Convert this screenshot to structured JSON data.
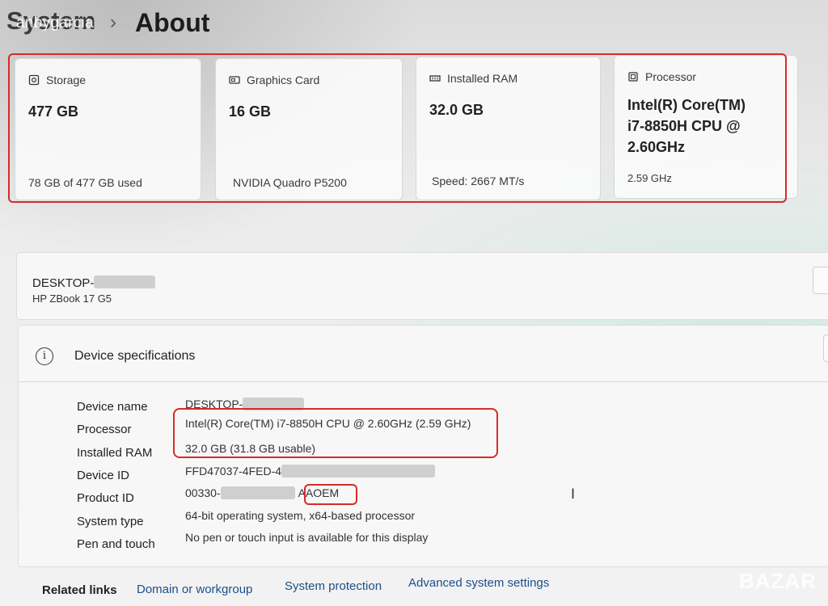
{
  "header": {
    "parent": "System",
    "watermark": "anbygarcia",
    "separator": "›",
    "current": "About"
  },
  "cards": [
    {
      "icon": "storage-icon",
      "title": "Storage",
      "value": "477 GB",
      "sub": "78 GB of 477 GB used"
    },
    {
      "icon": "graphics-card-icon",
      "title": "Graphics Card",
      "value": "16 GB",
      "sub": "NVIDIA Quadro P5200"
    },
    {
      "icon": "ram-icon",
      "title": "Installed RAM",
      "value": "32.0 GB",
      "sub": "Speed: 2667 MT/s"
    },
    {
      "icon": "processor-icon",
      "title": "Processor",
      "value": "Intel(R) Core(TM) i7-8850H CPU @ 2.60GHz",
      "sub": "2.59 GHz"
    }
  ],
  "device": {
    "name": "DESKTOP-",
    "model": "HP ZBook 17 G5"
  },
  "specs": {
    "title": "Device specifications",
    "rows": [
      {
        "label": "Device name",
        "value": "DESKTOP-"
      },
      {
        "label": "Processor",
        "value": "Intel(R) Core(TM) i7-8850H CPU @ 2.60GHz (2.59 GHz)"
      },
      {
        "label": "Installed RAM",
        "value": "32.0 GB (31.8 GB usable)"
      },
      {
        "label": "Device ID",
        "value": "FFD47037-4FED-4"
      },
      {
        "label": "Product ID",
        "value": "00330-",
        "value_suffix": "AAOEM"
      },
      {
        "label": "System type",
        "value": "64-bit operating system, x64-based processor"
      },
      {
        "label": "Pen and touch",
        "value": "No pen or touch input is available for this display"
      }
    ]
  },
  "related": {
    "label": "Related links",
    "links": [
      "Domain or workgroup",
      "System protection",
      "Advanced system settings"
    ]
  },
  "brand_watermark": "BAZAR",
  "colors": {
    "highlight": "#d62b2b",
    "link": "#1d4e8a"
  }
}
